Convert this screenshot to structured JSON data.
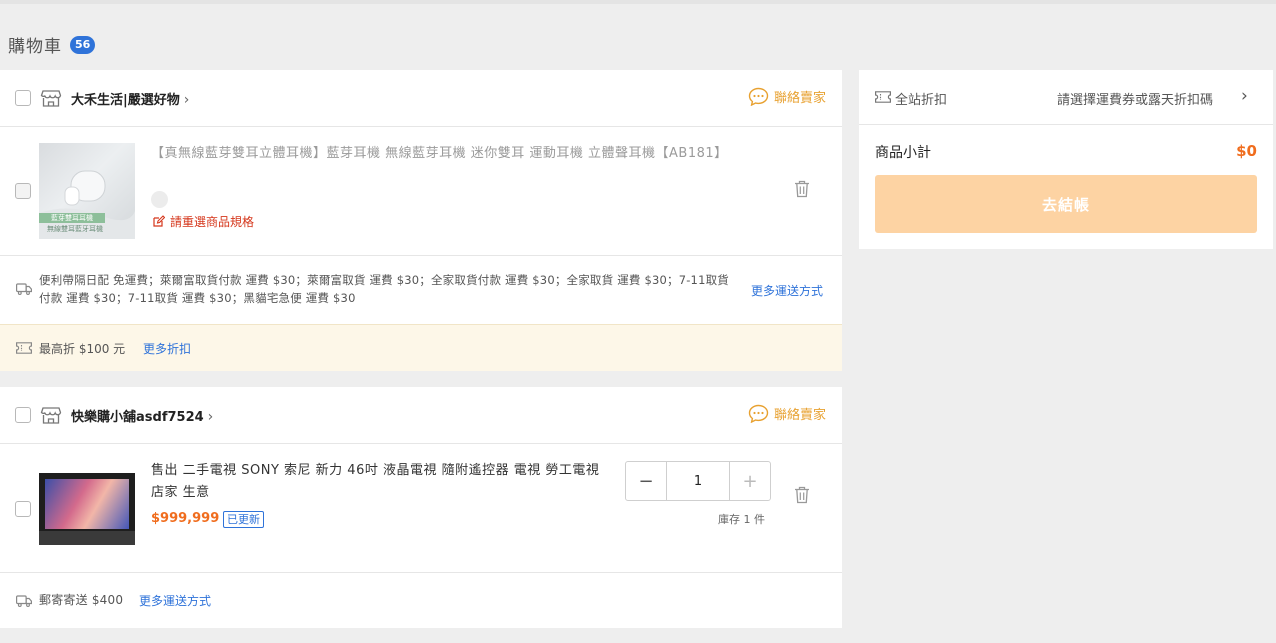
{
  "header": {
    "title": "購物車",
    "count": "56"
  },
  "stores": [
    {
      "name": "大禾生活|嚴選好物",
      "contact_label": "聯絡賣家",
      "item": {
        "title": "【真無線藍芽雙耳立體耳機】藍芽耳機 無線藍芽耳機 迷你雙耳 運動耳機 立體聲耳機【AB181】",
        "reselect_label": "請重選商品規格",
        "thumb_caption_1": "藍芽雙耳耳機",
        "thumb_caption_2": "無線雙耳藍牙耳機"
      },
      "shipping": {
        "text": "便利帶隔日配 免運費；萊爾富取貨付款 運費 $30；萊爾富取貨 運費 $30；全家取貨付款 運費 $30；全家取貨 運費 $30；7-11取貨付款 運費 $30；7-11取貨 運費 $30；黑貓宅急便 運費 $30",
        "more_label": "更多運送方式"
      },
      "discount": {
        "text": "最高折 $100 元",
        "more_label": "更多折扣"
      }
    },
    {
      "name": "快樂購小舖asdf7524",
      "contact_label": "聯絡賣家",
      "item": {
        "title": "售出 二手電視 SONY 索尼 新力 46吋 液晶電視 隨附遙控器 電視 勞工電視 店家 生意",
        "price": "$999,999",
        "updated_badge": "已更新",
        "quantity": "1",
        "minus": "−",
        "plus": "+",
        "stock": "庫存 1 件"
      },
      "shipping": {
        "text": "郵寄寄送 $400",
        "more_label": "更多運送方式"
      }
    }
  ],
  "summary": {
    "coupon_label": "全站折扣",
    "coupon_hint": "請選擇運費券或露天折扣碼",
    "subtotal_label": "商品小計",
    "subtotal_value": "$0",
    "checkout_label": "去結帳"
  },
  "colors": {
    "accent_orange": "#f06d1e",
    "link_blue": "#2f73d9",
    "contact_orange": "#e8a130",
    "badge_blue": "#2f73d9",
    "checkout_bg": "#fdd3a3",
    "discount_bg": "#fdf7e8"
  },
  "icons": {
    "shop": "storefront-icon",
    "chat": "chat-bubble-icon",
    "trash": "trash-icon",
    "truck": "truck-icon",
    "ticket": "ticket-icon",
    "edit": "edit-icon",
    "chevron": "chevron-right-icon"
  }
}
